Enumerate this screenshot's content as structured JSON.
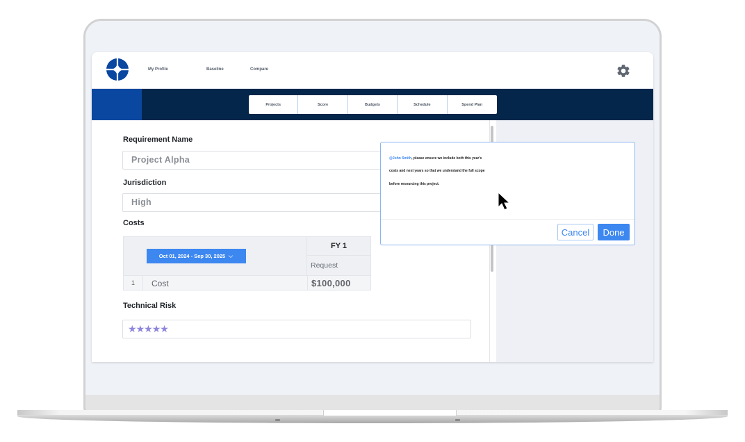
{
  "topnav": {
    "items": [
      {
        "label": "My Profile"
      },
      {
        "label": "Baseline"
      },
      {
        "label": "Compare"
      }
    ],
    "settings_icon": "gear-icon",
    "logo_icon": "compass-logo-icon"
  },
  "tabs": [
    {
      "label": "Projects"
    },
    {
      "label": "Score"
    },
    {
      "label": "Budgets"
    },
    {
      "label": "Schedule"
    },
    {
      "label": "Spend Plan"
    }
  ],
  "form": {
    "requirement_name": {
      "label": "Requirement Name",
      "value": "Project Alpha"
    },
    "jurisdiction": {
      "label": "Jurisdiction",
      "value": "High"
    },
    "costs": {
      "label": "Costs",
      "date_range": "Oct 01, 2024 - Sep 30, 2025",
      "fiscal_year": "FY 1",
      "column_subheader": "Request",
      "rows": [
        {
          "index": "1",
          "name": "Cost",
          "value": "$100,000"
        }
      ]
    },
    "technical_risk": {
      "label": "Technical Risk",
      "rating": 5,
      "max_rating": 5,
      "star_glyph": "★"
    }
  },
  "comment": {
    "mention": "@John Smith",
    "line1": ", please ensure we include both this year's",
    "line2": "costs and next years so that we understand the full scope",
    "line3": "before resourcing this project.",
    "cancel_label": "Cancel",
    "done_label": "Done"
  },
  "colors": {
    "navy": "#04264a",
    "brand_blue": "#0a47a0",
    "accent_blue": "#3d87f0",
    "star_purple": "#8f86dc"
  }
}
